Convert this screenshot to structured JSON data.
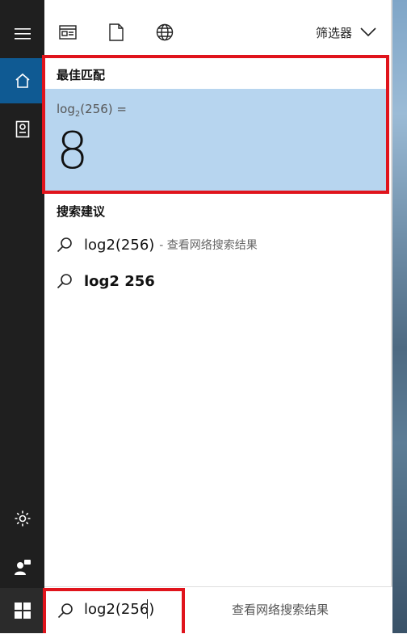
{
  "topbar": {
    "icons": [
      "apps-icon",
      "document-icon",
      "web-icon"
    ],
    "filter_label": "筛选器"
  },
  "best_match": {
    "title": "最佳匹配",
    "expression_prefix": "log",
    "expression_sub": "2",
    "expression_suffix": "(256) =",
    "result": "8"
  },
  "suggestions": {
    "title": "搜索建议",
    "items": [
      {
        "text": "log2(256)",
        "hint": "- 查看网络搜索结果"
      },
      {
        "text": "log2 256",
        "hint": ""
      }
    ]
  },
  "search": {
    "value": "log2(256)",
    "hint": "查看网络搜索结果"
  },
  "colors": {
    "rail": "#1f1f1f",
    "rail_active": "#0f5a93",
    "best_card": "#b7d5ef",
    "highlight_frame": "#e0141c"
  }
}
